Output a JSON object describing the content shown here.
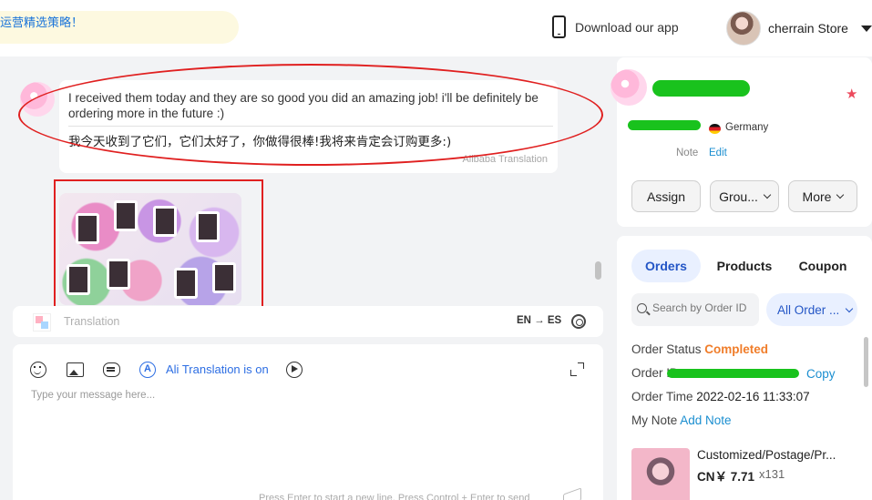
{
  "header": {
    "banner_text": "运营精选策略！",
    "download_app": "Download our app",
    "store_name": "cherrain Store"
  },
  "chat": {
    "message_en": "I received them today and they are so good you did an amazing job! i'll be definitely be ordering more in the future :)",
    "message_cn": "我今天收到了它们，它们太好了，你做得很棒!我将来肯定会订购更多:)",
    "translation_credit": "Alibaba Translation"
  },
  "translation_bar": {
    "placeholder": "Translation",
    "lang_pair": "EN → ES"
  },
  "composer": {
    "ali_translation": "Ali Translation is on",
    "placeholder": "Type your message here...",
    "hint": "Press Enter to start a new line, Press Control + Enter to send"
  },
  "customer": {
    "country": "Germany",
    "note_label": "Note",
    "edit_label": "Edit",
    "buttons": {
      "assign": "Assign",
      "group": "Grou...",
      "more": "More"
    }
  },
  "orders": {
    "tabs": [
      "Orders",
      "Products",
      "Coupon"
    ],
    "search_placeholder": "Search by Order ID",
    "filter": "All Order ...",
    "status_label": "Order Status",
    "status_value": "Completed",
    "id_label": "Order ID",
    "copy_label": "Copy",
    "time_label": "Order Time",
    "time_value": "2022-02-16 11:33:07",
    "note_label": "My Note",
    "add_note": "Add Note",
    "product": {
      "title": "Customized/Postage/Pr...",
      "price": "CN￥ 7.71",
      "qty": "x131"
    }
  },
  "colors": {
    "annotation_red": "#e02020",
    "redaction_green": "#19c21d",
    "link_blue": "#1a8ed0",
    "status_orange": "#f07d2a"
  }
}
